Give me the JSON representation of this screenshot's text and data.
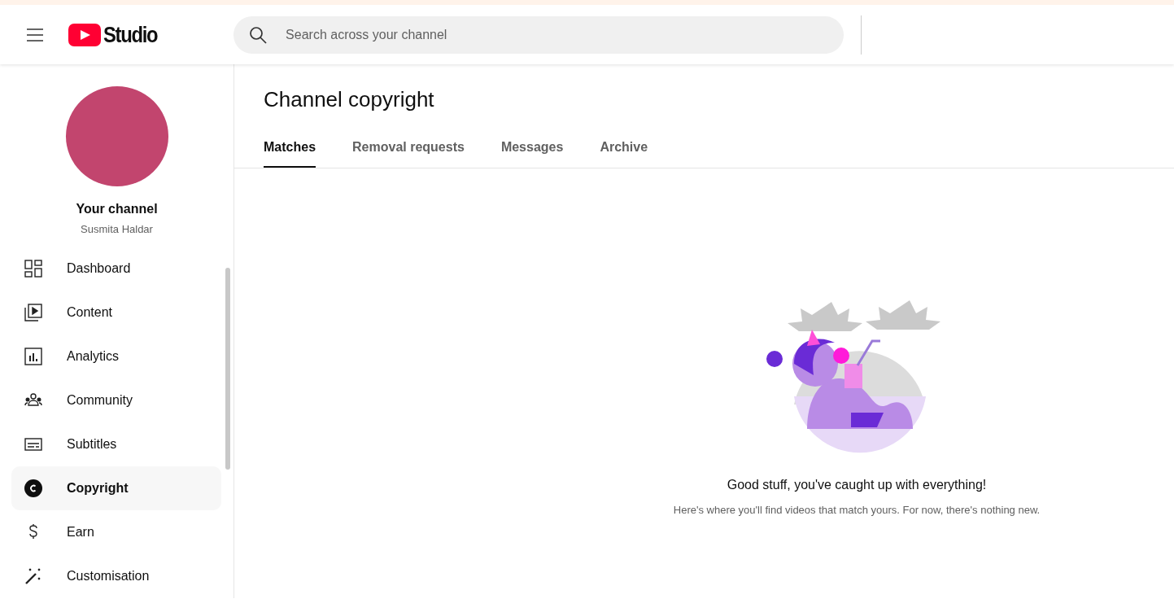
{
  "topbar": {
    "logo_text": "Studio",
    "search": {
      "placeholder": "Search across your channel"
    }
  },
  "sidebar": {
    "channel_title": "Your channel",
    "channel_name": "Susmita Haldar",
    "items": [
      {
        "label": "Dashboard",
        "kind": "dashboard",
        "selected": false
      },
      {
        "label": "Content",
        "kind": "content",
        "selected": false
      },
      {
        "label": "Analytics",
        "kind": "analytics",
        "selected": false
      },
      {
        "label": "Community",
        "kind": "community",
        "selected": false
      },
      {
        "label": "Subtitles",
        "kind": "subtitles",
        "selected": false
      },
      {
        "label": "Copyright",
        "kind": "copyright",
        "selected": true
      },
      {
        "label": "Earn",
        "kind": "earn",
        "selected": false
      },
      {
        "label": "Customisation",
        "kind": "customisation",
        "selected": false
      }
    ]
  },
  "main": {
    "title": "Channel copyright",
    "tabs": [
      {
        "label": "Matches",
        "selected": true
      },
      {
        "label": "Removal requests",
        "selected": false
      },
      {
        "label": "Messages",
        "selected": false
      },
      {
        "label": "Archive",
        "selected": false
      }
    ],
    "empty_state": {
      "heading": "Good stuff, you've caught up with everything!",
      "text": "Here's where you'll find videos that match yours. For now, there's nothing new."
    }
  }
}
